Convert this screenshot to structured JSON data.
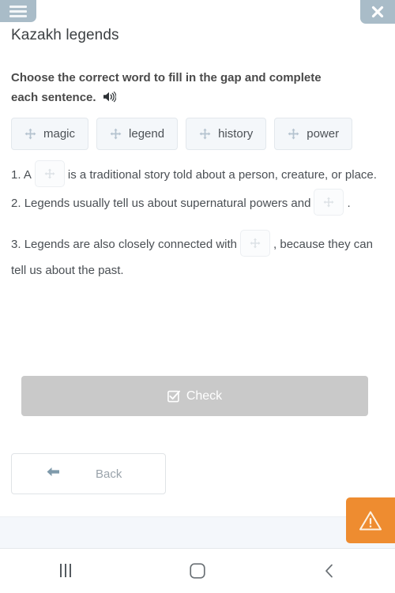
{
  "topbar": {
    "menu_icon": "hamburger-menu-icon",
    "close_icon": "close-icon"
  },
  "header": {
    "title": "Kazakh legends"
  },
  "task": {
    "instruction": "Choose the correct word to fill in the gap and complete each sentence.",
    "audio_icon": "speaker-icon"
  },
  "word_bank": {
    "drag_icon": "move-arrows-icon",
    "chips": [
      {
        "label": "magic"
      },
      {
        "label": "legend"
      },
      {
        "label": "history"
      },
      {
        "label": "power"
      }
    ]
  },
  "sentences": [
    {
      "number": "1.",
      "before": "A",
      "after": "is a traditional story told about a person, creature, or place.",
      "blank_icon": "move-arrows-icon"
    },
    {
      "number": "2.",
      "before": "Legends usually tell us about supernatural powers and",
      "after": ".",
      "blank_icon": "move-arrows-icon"
    },
    {
      "number": "3.",
      "before": "Legends are also closely connected with",
      "after": ", because they can tell us about the past.",
      "blank_icon": "move-arrows-icon"
    }
  ],
  "actions": {
    "check_label": "Check",
    "check_icon": "checkbox-checked-icon",
    "back_label": "Back",
    "back_icon": "arrow-left-icon",
    "warning_icon": "warning-triangle-icon"
  },
  "navbar": {
    "recents_icon": "recents-icon",
    "home_icon": "home-icon",
    "back_icon": "back-chevron-icon"
  },
  "colors": {
    "topbar_button": "#a9bcc8",
    "chip_background": "#f4f7fa",
    "check_button": "#c9c9c9",
    "warning_accent": "#ee8c30",
    "footer_strip": "#f4f7fb",
    "text_primary": "#4a4f54"
  }
}
